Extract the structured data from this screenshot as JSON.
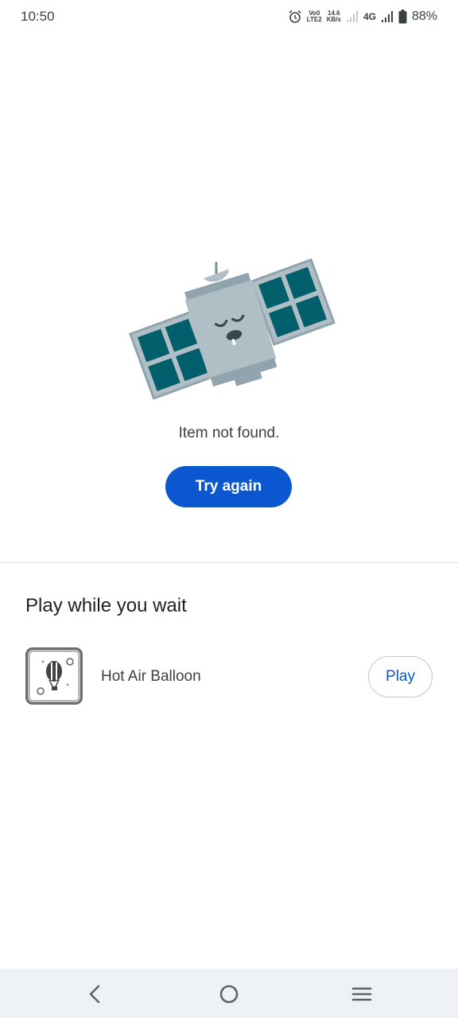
{
  "status_bar": {
    "time": "10:50",
    "volte_top": "Vo0",
    "volte_bottom": "LTE2",
    "speed_value": "14.6",
    "speed_unit": "KB/s",
    "network": "4G",
    "battery": "88%",
    "icons": [
      "alarm-icon",
      "signal-weak-icon",
      "signal-strong-icon",
      "battery-icon"
    ]
  },
  "error": {
    "illustration": "sleeping-satellite",
    "message": "Item not found.",
    "retry_label": "Try again"
  },
  "play_section": {
    "title": "Play while you wait",
    "games": [
      {
        "name": "Hot Air Balloon",
        "icon": "hot-air-balloon-icon",
        "action_label": "Play"
      }
    ]
  },
  "nav_bar": {
    "buttons": [
      "back-icon",
      "home-icon",
      "menu-icon"
    ]
  },
  "colors": {
    "accent": "#0b57d0",
    "panel": "#005f6b",
    "satellite_body": "#b0bec5",
    "nav_background": "#eef1f6"
  }
}
